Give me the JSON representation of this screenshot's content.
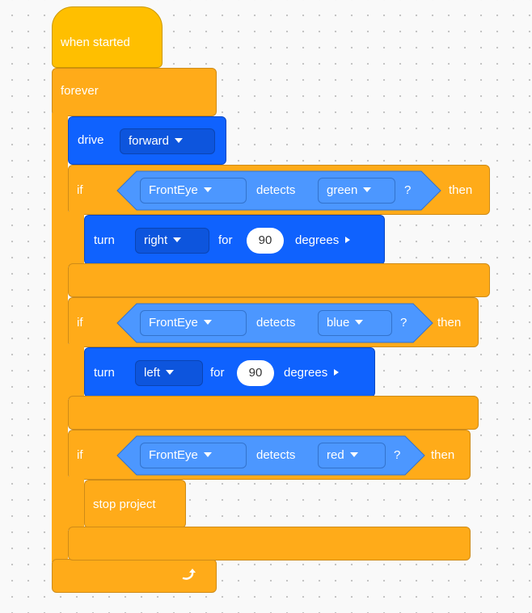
{
  "hat": {
    "label": "when started"
  },
  "forever": {
    "label": "forever",
    "loop_icon": "loop-arrow-icon"
  },
  "drive": {
    "label": "drive",
    "direction": "forward"
  },
  "if_green": {
    "if_label": "if",
    "sensor": "FrontEye",
    "detects": "detects",
    "color": "green",
    "qmark": "?",
    "then_label": "then",
    "turn": {
      "label": "turn",
      "direction": "right",
      "for": "for",
      "degrees_value": "90",
      "degrees_label": "degrees"
    }
  },
  "if_blue": {
    "if_label": "if",
    "sensor": "FrontEye",
    "detects": "detects",
    "color": "blue",
    "qmark": "?",
    "then_label": "then",
    "turn": {
      "label": "turn",
      "direction": "left",
      "for": "for",
      "degrees_value": "90",
      "degrees_label": "degrees"
    }
  },
  "if_red": {
    "if_label": "if",
    "sensor": "FrontEye",
    "detects": "detects",
    "color": "red",
    "qmark": "?",
    "then_label": "then",
    "stop": {
      "label": "stop project"
    }
  },
  "colors": {
    "control_orange": "#ffab19",
    "event_yellow": "#ffbf00",
    "motion_blue": "#0f62fe",
    "sensing_light_blue": "#4c97ff",
    "canvas_bg": "#f9f9f9"
  }
}
